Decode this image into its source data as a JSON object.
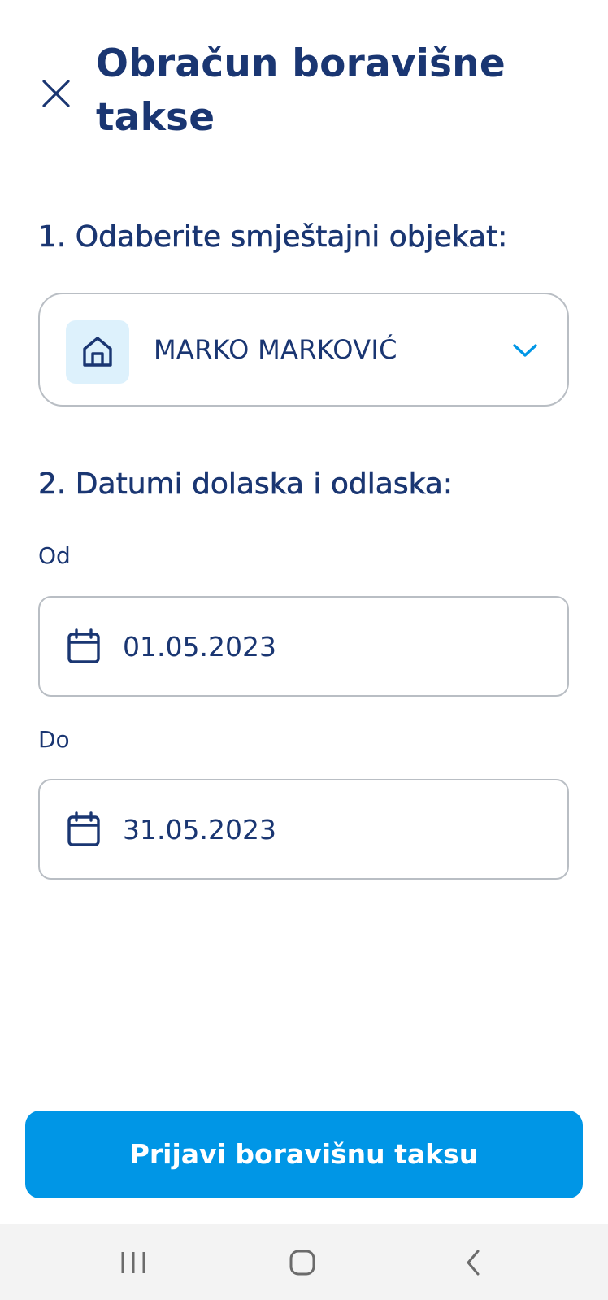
{
  "header": {
    "title": "Obračun boravišne takse",
    "close_icon": "close-icon"
  },
  "section1": {
    "label": "1. Odaberite smještajni objekat:",
    "property_select": {
      "icon": "home-icon",
      "selected_value": "MARKO MARKOVIĆ",
      "chevron_icon": "chevron-down-icon"
    }
  },
  "section2": {
    "label": "2. Datumi dolaska i odlaska:",
    "from": {
      "label": "Od",
      "icon": "calendar-icon",
      "value": "01.05.2023"
    },
    "to": {
      "label": "Do",
      "icon": "calendar-icon",
      "value": "31.05.2023"
    }
  },
  "submit": {
    "label": "Prijavi boravišnu taksu"
  },
  "system_nav": {
    "recents_icon": "recents-icon",
    "home_icon": "home-outline-icon",
    "back_icon": "back-icon"
  },
  "colors": {
    "primary_text": "#1a3672",
    "accent": "#0096e6",
    "icon_tile_bg": "#ddf1fc",
    "border": "#b9bec4",
    "navbar_bg": "#f3f3f3"
  }
}
